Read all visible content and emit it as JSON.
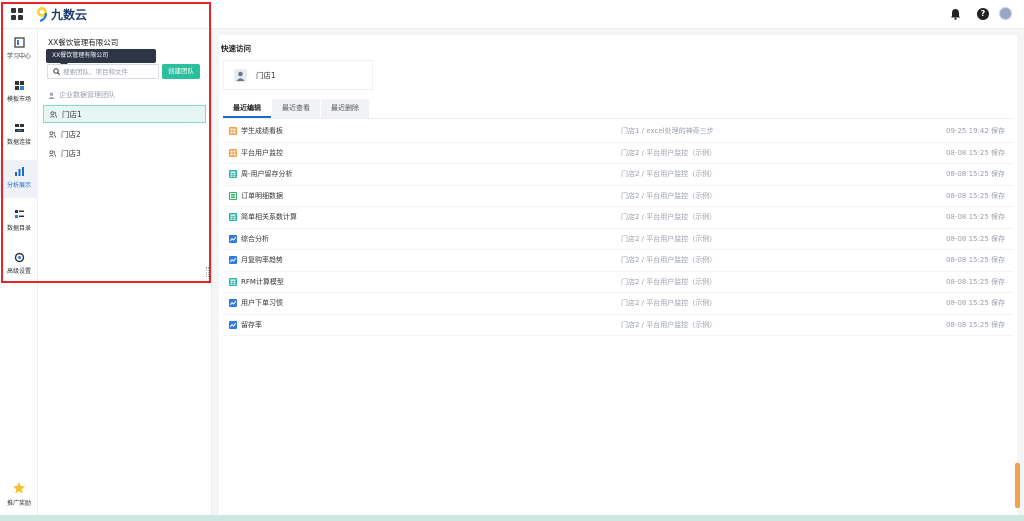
{
  "header": {
    "logo_text": "九数云",
    "icons": [
      "apps-icon",
      "bell-icon",
      "help-icon",
      "user-avatar"
    ],
    "help_glyph": "?"
  },
  "nav": {
    "items": [
      {
        "label": "学习中心",
        "icon": "learning-icon",
        "active": false
      },
      {
        "label": "模板市场",
        "icon": "template-icon",
        "active": false
      },
      {
        "label": "数据连接",
        "icon": "data-connect-icon",
        "active": false
      },
      {
        "label": "分析展示",
        "icon": "analysis-icon",
        "active": true
      },
      {
        "label": "数据目录",
        "icon": "data-catalog-icon",
        "active": false
      },
      {
        "label": "高级设置",
        "icon": "settings-icon",
        "active": false
      }
    ],
    "promo_label": "推广奖励"
  },
  "panel": {
    "company": "XX餐饮管理有限公司",
    "tooltip": "XX餐饮管理有限公司",
    "search_placeholder": "搜索团队、项目和文件",
    "create_button": "创建团队",
    "tree_header": "企业数据管理团队",
    "teams": [
      {
        "label": "门店1",
        "selected": true
      },
      {
        "label": "门店2",
        "selected": false
      },
      {
        "label": "门店3",
        "selected": false
      }
    ]
  },
  "main": {
    "quick_access_title": "快速访问",
    "quick_access_card": "门店1",
    "tabs": [
      "最近编辑",
      "最近查看",
      "最近删除"
    ],
    "active_tab": 0,
    "rows": [
      {
        "name": "学生成绩看板",
        "path": "门店1 / excel处理的神奇三步",
        "time": "09-25 19:42 保存",
        "icon": "dashboard-icon"
      },
      {
        "name": "平台用户监控",
        "path": "门店2 / 平台用户监控（示例）",
        "time": "08-08 15:25 保存",
        "icon": "dashboard-icon"
      },
      {
        "name": "周-用户留存分析",
        "path": "门店2 / 平台用户监控（示例）",
        "time": "08-08 15:25 保存",
        "icon": "table-icon"
      },
      {
        "name": "订单明细数据",
        "path": "门店2 / 平台用户监控（示例）",
        "time": "08-08 15:25 保存",
        "icon": "sheet-icon"
      },
      {
        "name": "简单相关系数计算",
        "path": "门店2 / 平台用户监控（示例）",
        "time": "08-08 15:25 保存",
        "icon": "table-icon"
      },
      {
        "name": "综合分析",
        "path": "门店2 / 平台用户监控（示例）",
        "time": "08-08 15:25 保存",
        "icon": "chart-icon"
      },
      {
        "name": "月复购率趋势",
        "path": "门店2 / 平台用户监控（示例）",
        "time": "08-08 15:25 保存",
        "icon": "chart-icon"
      },
      {
        "name": "RFM计算模型",
        "path": "门店2 / 平台用户监控（示例）",
        "time": "08-08 15:25 保存",
        "icon": "table-icon"
      },
      {
        "name": "用户下单习惯",
        "path": "门店2 / 平台用户监控（示例）",
        "time": "08-08 15:25 保存",
        "icon": "chart-icon"
      },
      {
        "name": "留存率",
        "path": "门店2 / 平台用户监控（示例）",
        "time": "08-08 15:25 保存",
        "icon": "chart-icon"
      }
    ]
  },
  "colors": {
    "accent": "#1a6cc9",
    "create_button": "#2abf9e",
    "highlight_box": "#e8242b",
    "dashboard_icon": "#f0a14a",
    "table_icon": "#2bb5a7",
    "sheet_icon": "#3bb36a",
    "chart_icon": "#2f7be0"
  }
}
